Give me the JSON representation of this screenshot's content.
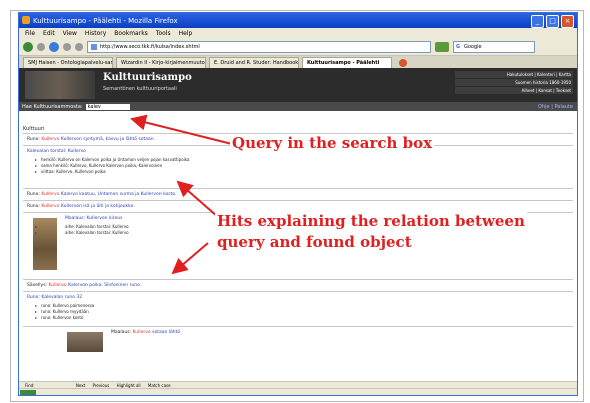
{
  "window": {
    "title": "Kulttuurisampo - Päälehti - Mozilla Firefox",
    "menu": [
      "File",
      "Edit",
      "View",
      "History",
      "Bookmarks",
      "Tools",
      "Help"
    ],
    "url": "http://www.seco.tkk.fi/kulsa/index.shtml",
    "search_engine": "Google",
    "tabs": [
      {
        "label": "SMJ Haisen - Ontologiapalvelu-sanast...",
        "active": false
      },
      {
        "label": "Wizardin II - Kirjo-kirjaimenmuutoksia",
        "active": false
      },
      {
        "label": "E. Druid and R. Studer: Handbook on ...",
        "active": false
      },
      {
        "label": "Kulttuurisampo - Päälehti",
        "active": true
      }
    ]
  },
  "site": {
    "title": "Kulttuurisampo",
    "subtitle": "Semanttinen kulttuuriportaali",
    "links": [
      "Hakutulokset | Kalenteri | Kartta",
      "Suomen historia 1860-1950",
      "Aiheet | Kansat | Teokset"
    ],
    "search_label": "Hae Kulttuurisammosta:",
    "search_value": "kalev",
    "right_links": "Ohje | Palaute"
  },
  "content": {
    "crumb": "Kulttuuri",
    "results": [
      {
        "prefix": "Runo:",
        "highlight": "Kullervo",
        "rest": "Kullervon syntymä, kasvu ja lähtö sotaan."
      },
      {
        "prefix": "Runo:",
        "highlight": "Kullervo",
        "rest": "Kalervo kaatuu, Untamon surma ja Kullervon kosto."
      },
      {
        "prefix": "Runo:",
        "highlight": "Kullervo",
        "rest": "Kullervon isä ja äiti ja kotijoukko."
      },
      {
        "prefix": "Runo:",
        "highlight": "Kullervo",
        "rest": "Kullervon paluu kotiin ja surma."
      }
    ],
    "block1": {
      "head": "Kalevalan torstai: Kullervo",
      "bullets": [
        "henkilö: Kullervo on Kalervon poika ja Untamon veljen pojan kasvattipoika",
        "sama henkilö: Kullervo, Kullervo Kalervon poika, Kalervoinen",
        "viittaa: Kullervo, Kullervon poika"
      ]
    },
    "block2": {
      "head": "Maalaus: Kullervon kirous",
      "bullets": [
        "aihe: Kalevalan torstai: Kullervo",
        "aihe: Kalevalan torstai: Kullervo"
      ]
    },
    "block3": {
      "head": "Sävellys:",
      "highlight": "Kullervo",
      "rest": "Kalervon poika. Sinfoninen runo."
    },
    "block4": {
      "head": "Runo: Kalevalan runo 32",
      "bullets": [
        "runo: Kullervo paimenessa",
        "runo: Kullervo myydään",
        "runo: Kullervon kosto"
      ]
    },
    "block5": {
      "head": "Maalaus:",
      "highlight": "Kullervo",
      "rest": "sotaan lähtö"
    }
  },
  "findbar": {
    "label": "Find:",
    "next": "Next",
    "previous": "Previous",
    "highlight": "Highlight all",
    "match_case": "Match case"
  },
  "annotations": {
    "query": "Query in the search box",
    "hits_line1": "Hits explaining the relation between",
    "hits_line2": "query and found object"
  },
  "colors": {
    "annotation": "#e02020",
    "highlight": "#e03030",
    "link": "#2a3fb0",
    "titlebar": "#0a3fc0"
  }
}
